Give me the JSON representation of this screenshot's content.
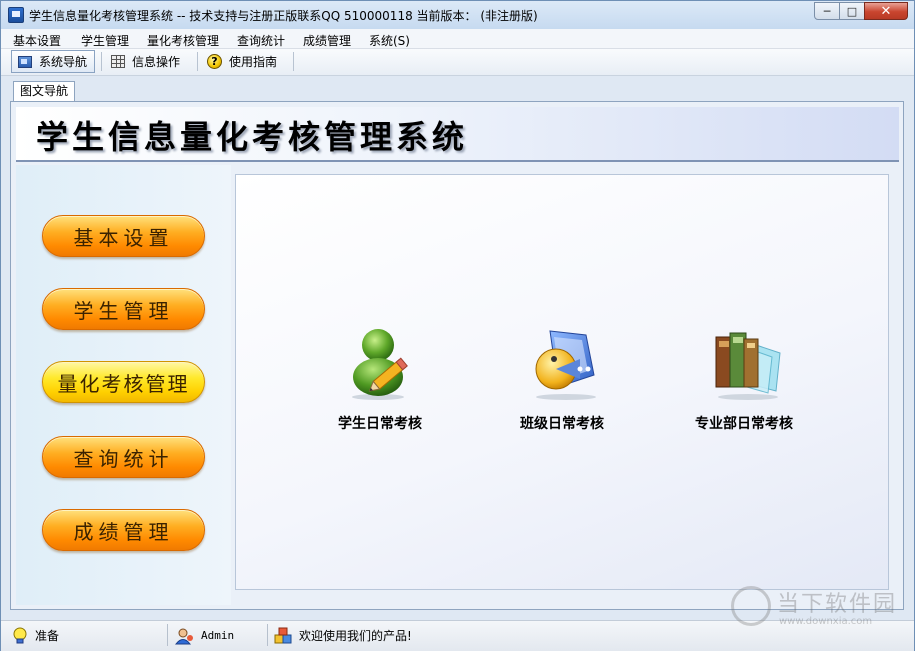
{
  "window": {
    "title": "学生信息量化考核管理系统 -- 技术支持与注册正版联系QQ 510000118    当前版本： (非注册版)",
    "buttons": {
      "minimize": "─",
      "maximize": "□",
      "close": "✕"
    }
  },
  "menu": [
    "基本设置",
    "学生管理",
    "量化考核管理",
    "查询统计",
    "成绩管理",
    "系统(S)"
  ],
  "toolbar": {
    "items": [
      {
        "label": "系统导航",
        "icon": "nav-window-icon",
        "active": true
      },
      {
        "label": "信息操作",
        "icon": "grid-icon",
        "active": false
      },
      {
        "label": "使用指南",
        "icon": "help-icon",
        "active": false
      }
    ]
  },
  "doc_tab": {
    "label": "图文导航"
  },
  "banner": {
    "title": "学生信息量化考核管理系统"
  },
  "nav_buttons": [
    "基本设置",
    "学生管理",
    "量化考核管理",
    "查询统计",
    "成绩管理"
  ],
  "cards": [
    {
      "label": "学生日常考核",
      "icon": "student-pencil-icon"
    },
    {
      "label": "班级日常考核",
      "icon": "class-folder-icon"
    },
    {
      "label": "专业部日常考核",
      "icon": "books-icon"
    }
  ],
  "status": {
    "ready": "准备",
    "user": "Admin",
    "welcome": "欢迎使用我们的产品!"
  },
  "watermark": {
    "text": "当下软件园",
    "url": "www.downxia.com"
  },
  "colors": {
    "nav_orange": "#ff9a00",
    "nav_yellow": "#ffe000",
    "banner_end": "#d3dcf4"
  }
}
